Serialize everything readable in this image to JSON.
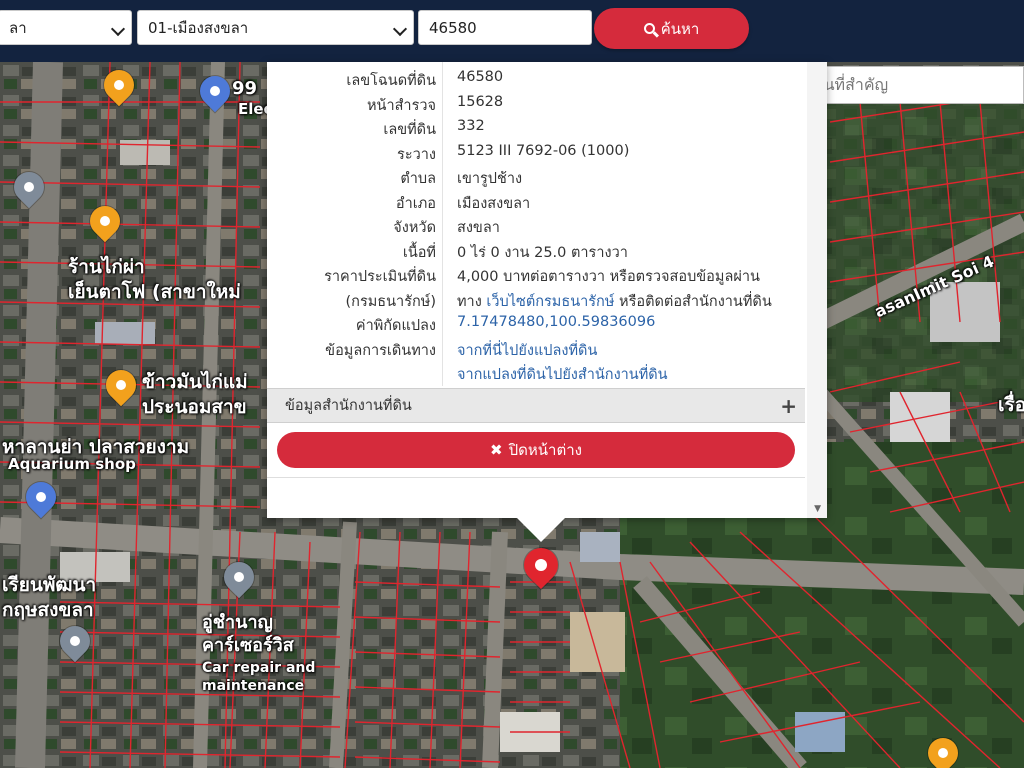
{
  "topbar": {
    "province_value": "ลา",
    "district_value": "01-เมืองสงขลา",
    "parcel_number_value": "46580",
    "search_label": "ค้นหา"
  },
  "map_search": {
    "placeholder": "ค้นหาสถานที่สำคัญ"
  },
  "parcel": {
    "rows": [
      {
        "label": "เลขโฉนดที่ดิน",
        "value": "46580"
      },
      {
        "label": "หน้าสำรวจ",
        "value": "15628"
      },
      {
        "label": "เลขที่ดิน",
        "value": "332"
      },
      {
        "label": "ระวาง",
        "value": "5123 III 7692-06 (1000)"
      },
      {
        "label": "ตำบล",
        "value": "เขารูปช้าง"
      },
      {
        "label": "อำเภอ",
        "value": "เมืองสงขลา"
      },
      {
        "label": "จังหวัด",
        "value": "สงขลา"
      },
      {
        "label": "เนื้อที่",
        "value": "0 ไร่ 0 งาน 25.0 ตารางวา"
      }
    ],
    "price_label_1": "ราคาประเมินที่ดิน",
    "price_label_2": "(กรมธนารักษ์)",
    "price_line_1": "4,000 บาทต่อตารางวา หรือตรวจสอบข้อมูลผ่าน",
    "price_line_2_prefix": "ทาง",
    "price_line_2_link": "เว็บไซต์กรมธนารักษ์",
    "price_line_2_suffix": "หรือติดต่อสำนักงานที่ดิน",
    "coord_label": "ค่าพิกัดแปลง",
    "coord_value": "7.17478480,100.59836096",
    "travel_label": "ข้อมูลการเดินทาง",
    "travel_link_1": "จากที่นี่ไปยังแปลงที่ดิน",
    "travel_link_2": "จากแปลงที่ดินไปยังสำนักงานที่ดิน",
    "office_section_label": "ข้อมูลสำนักงานที่ดิน",
    "expand_symbol": "+",
    "close_label": "ปิดหน้าต่าง"
  },
  "map_labels": {
    "poi_99": "99",
    "poi_elec": "Elec",
    "restaurant_1a": "ร้านไก่ผ่า",
    "restaurant_1b": "เย็นตาโฟ (สาขาใหม่",
    "rice_1": "ข้าวมันไก่แม่",
    "rice_2": "ประนอมสาข",
    "aquarium_1": "หาลานย่า ปลาสวยงาม",
    "aquarium_2": "Aquarium shop",
    "school_1": "เรียนพัฒนา",
    "school_2": "กฤษสงขลา",
    "car_1": "อู่ชำนาญ",
    "car_2": "คาร์เซอร์วิส",
    "car_3": "Car repair and",
    "car_4": "maintenance",
    "street": "asanImit Soi 4",
    "edge_right": "เรื่อ"
  },
  "colors": {
    "topbar_bg": "#13233f",
    "accent": "#d52b3c",
    "parcel_lines": "#e0252e",
    "link": "#2c63a8"
  },
  "icons": [
    "search-icon",
    "chevron-down-icon",
    "close-icon",
    "plus-icon",
    "map-pin-icon",
    "restaurant-pin-icon",
    "shopping-pin-icon"
  ]
}
